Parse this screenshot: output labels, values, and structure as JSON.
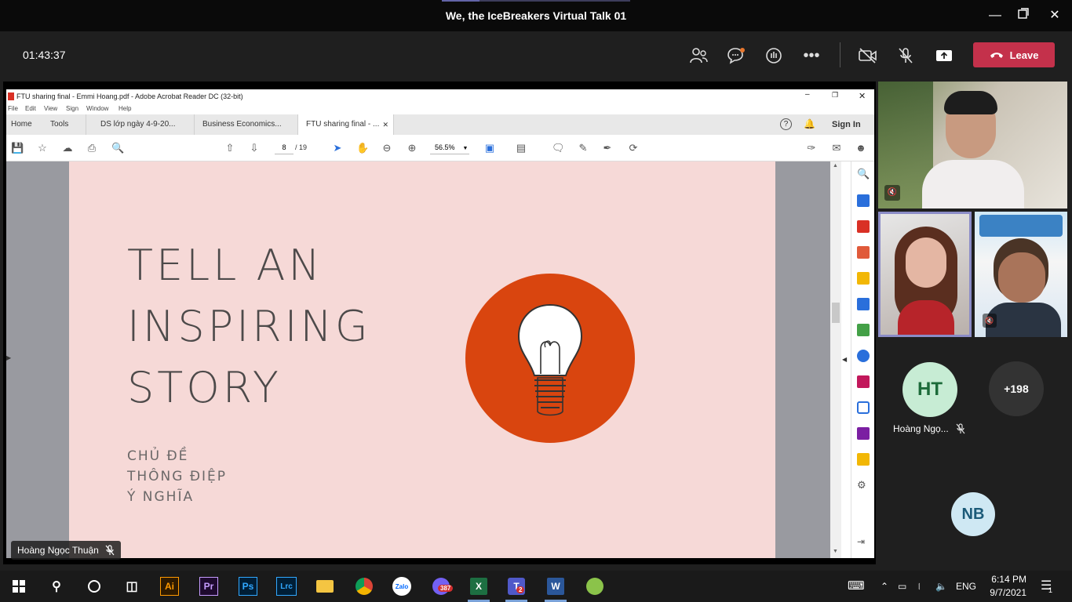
{
  "window": {
    "title": "We, the IceBreakers Virtual Talk 01"
  },
  "meeting": {
    "timer": "01:43:37",
    "leave_label": "Leave",
    "colors": {
      "leave": "#c4314b",
      "background": "#1f1f1f"
    }
  },
  "acrobat": {
    "window_title": "FTU sharing final - Emmi Hoang.pdf - Adobe Acrobat Reader DC (32-bit)",
    "menu": [
      "File",
      "Edit",
      "View",
      "Sign",
      "Window",
      "Help"
    ],
    "home_label": "Home",
    "tools_label": "Tools",
    "tabs": [
      "DS lớp ngày 4-9-20...",
      "Business Economics...",
      "FTU sharing final - ..."
    ],
    "sign_in": "Sign In",
    "page_current": "8",
    "page_total": "/ 19",
    "zoom": "56.5%"
  },
  "slide": {
    "heading_lines": [
      "TELL AN",
      "INSPIRING",
      "STORY"
    ],
    "sub_lines": [
      "CHỦ ĐỀ",
      "THÔNG ĐIỆP",
      "Ý NGHĨA"
    ],
    "colors": {
      "background": "#f6d9d7",
      "circle": "#d9450f",
      "text": "#4d4a4a"
    }
  },
  "presenter": {
    "name": "Hoàng Ngọc Thuận"
  },
  "participants": {
    "ht": {
      "initials": "HT",
      "name": "Hoàng Ngọ..."
    },
    "more": "+198",
    "nb": {
      "initials": "NB"
    }
  },
  "taskbar": {
    "apps": [
      "Ai",
      "Pr",
      "Ps",
      "Lrc",
      "Zalo"
    ],
    "viber_badge": "387",
    "teams_badge": "2",
    "lang": "ENG",
    "time": "6:14 PM",
    "date": "9/7/2021",
    "notifications": "1"
  }
}
